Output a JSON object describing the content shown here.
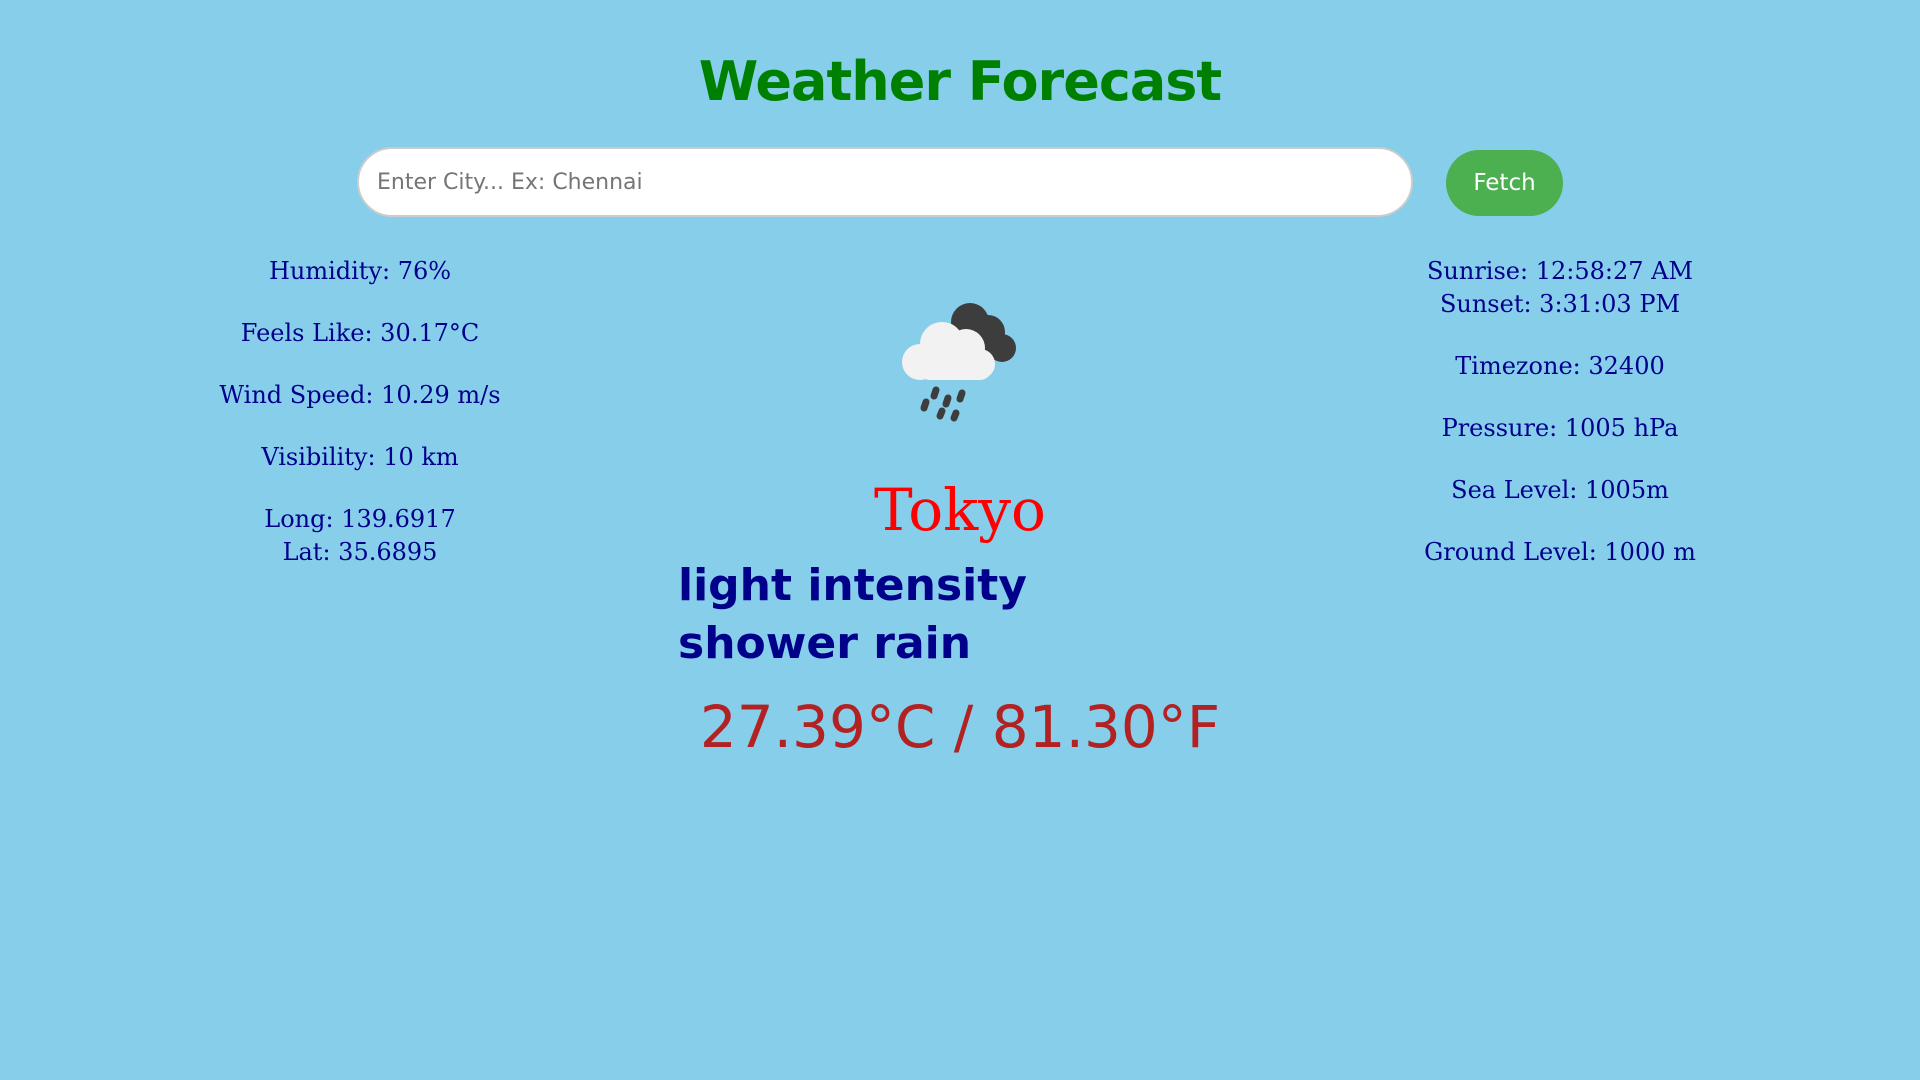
{
  "header": {
    "title": "Weather Forecast"
  },
  "search": {
    "placeholder": "Enter City... Ex: Chennai",
    "value": "",
    "button_label": "Fetch"
  },
  "left_stats": {
    "humidity": "Humidity: 76%",
    "feels_like": "Feels Like: 30.17°C",
    "wind_speed": "Wind Speed: 10.29 m/s",
    "visibility": "Visibility: 10 km",
    "longitude": "Long: 139.6917",
    "latitude": "Lat: 35.6895"
  },
  "right_stats": {
    "sunrise": "Sunrise: 12:58:27 AM",
    "sunset": "Sunset: 3:31:03 PM",
    "timezone": "Timezone: 32400",
    "pressure": "Pressure: 1005 hPa",
    "sea_level": "Sea Level: 1005m",
    "ground_level": "Ground Level: 1000 m"
  },
  "main": {
    "icon": "shower-rain-cloud-icon",
    "city": "Tokyo",
    "description": "light intensity shower rain",
    "temperature": "27.39°C / 81.30°F"
  },
  "colors": {
    "background": "#87ceeb",
    "title": "#008000",
    "button": "#4caf50",
    "stats_text": "#00008b",
    "city": "#ff0000",
    "temperature": "#b22222"
  }
}
